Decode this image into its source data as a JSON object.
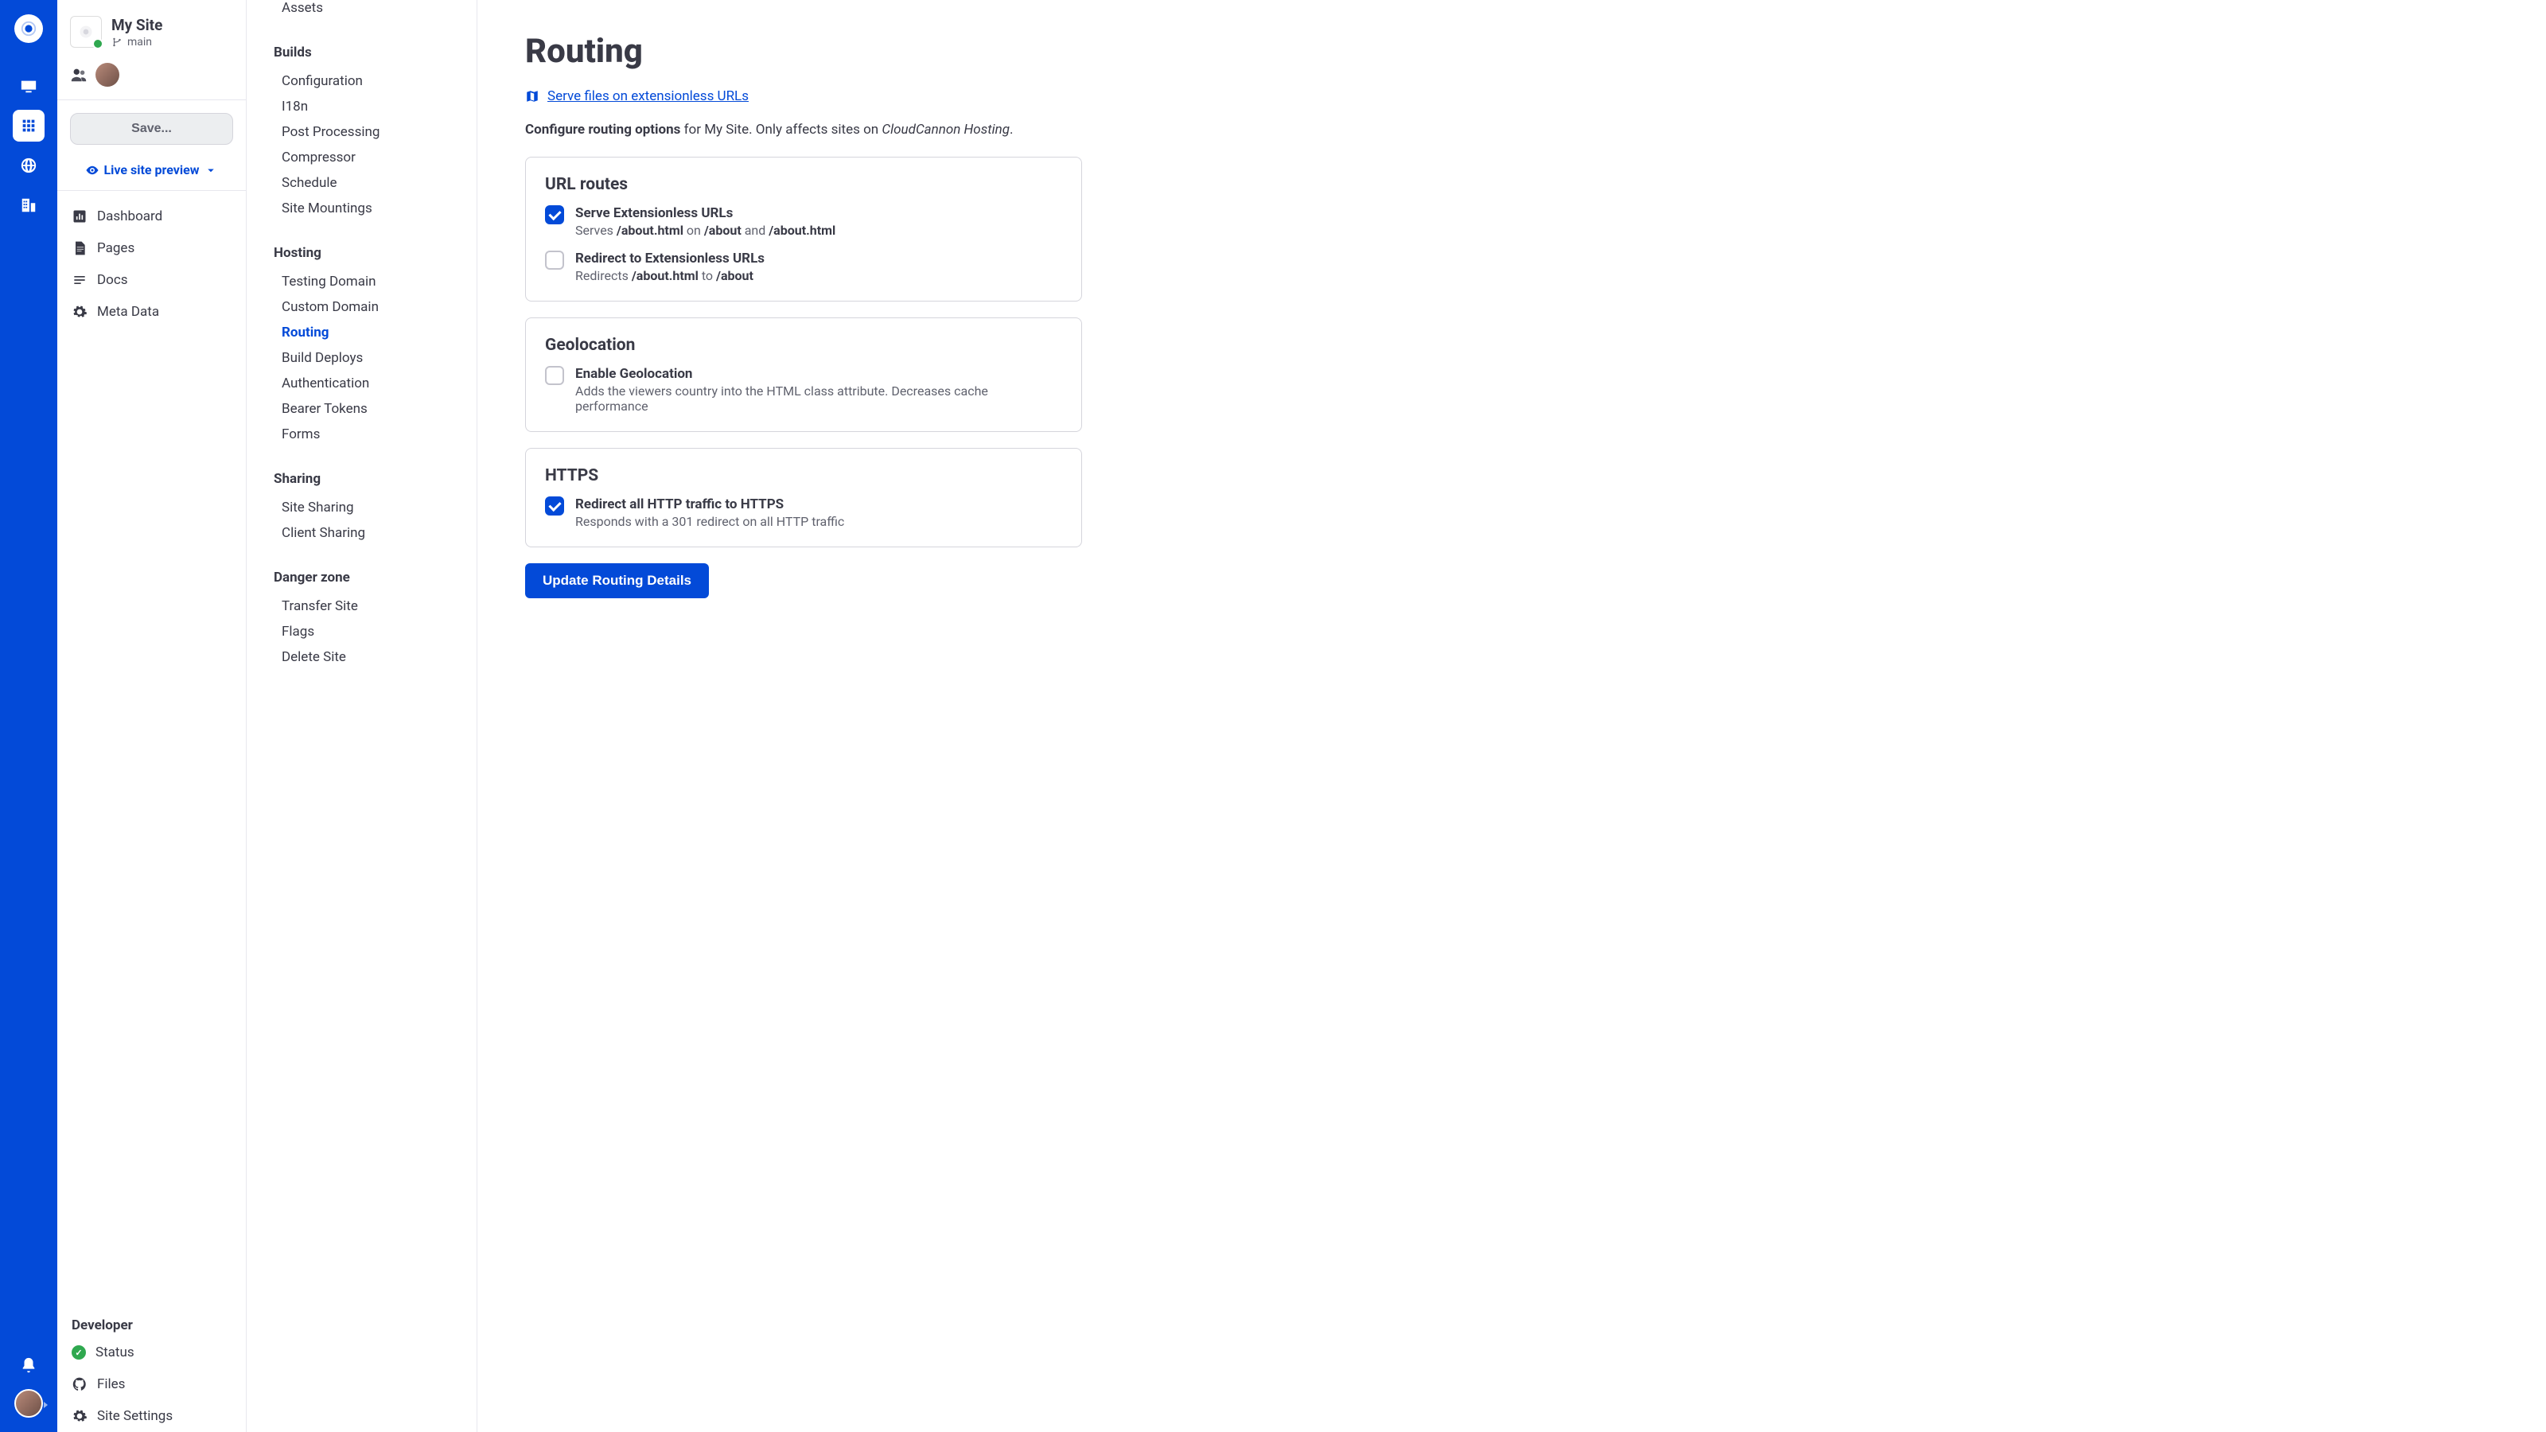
{
  "site": {
    "name": "My Site",
    "branch": "main"
  },
  "save_btn": "Save...",
  "preview_label": "Live site preview",
  "nav1": {
    "dashboard": "Dashboard",
    "pages": "Pages",
    "docs": "Docs",
    "metadata": "Meta Data"
  },
  "developer": {
    "header": "Developer",
    "status": "Status",
    "files": "Files",
    "settings": "Site Settings"
  },
  "s2": {
    "g0": {
      "assets": "Assets"
    },
    "builds": {
      "title": "Builds",
      "items": [
        "Configuration",
        "I18n",
        "Post Processing",
        "Compressor",
        "Schedule",
        "Site Mountings"
      ]
    },
    "hosting": {
      "title": "Hosting",
      "items": [
        "Testing Domain",
        "Custom Domain",
        "Routing",
        "Build Deploys",
        "Authentication",
        "Bearer Tokens",
        "Forms"
      ]
    },
    "sharing": {
      "title": "Sharing",
      "items": [
        "Site Sharing",
        "Client Sharing"
      ]
    },
    "danger": {
      "title": "Danger zone",
      "items": [
        "Transfer Site",
        "Flags",
        "Delete Site"
      ]
    }
  },
  "page": {
    "title": "Routing",
    "doc_link": "Serve files on extensionless URLs",
    "subtitle_bold": "Configure routing options",
    "subtitle_mid": " for My Site. Only affects sites on ",
    "subtitle_italic": "CloudCannon Hosting",
    "subtitle_end": "."
  },
  "card_routes": {
    "title": "URL routes",
    "opt1_label": "Serve Extensionless URLs",
    "opt1_desc_pre": "Serves ",
    "opt1_desc_b1": "/about.html",
    "opt1_desc_mid1": " on ",
    "opt1_desc_b2": "/about",
    "opt1_desc_mid2": " and ",
    "opt1_desc_b3": "/about.html",
    "opt2_label": "Redirect to Extensionless URLs",
    "opt2_desc_pre": "Redirects ",
    "opt2_desc_b1": "/about.html",
    "opt2_desc_mid": " to ",
    "opt2_desc_b2": "/about"
  },
  "card_geo": {
    "title": "Geolocation",
    "label": "Enable Geolocation",
    "desc": "Adds the viewers country into the HTML class attribute. Decreases cache performance"
  },
  "card_https": {
    "title": "HTTPS",
    "label": "Redirect all HTTP traffic to HTTPS",
    "desc": "Responds with a 301 redirect on all HTTP traffic"
  },
  "update_btn": "Update Routing Details"
}
